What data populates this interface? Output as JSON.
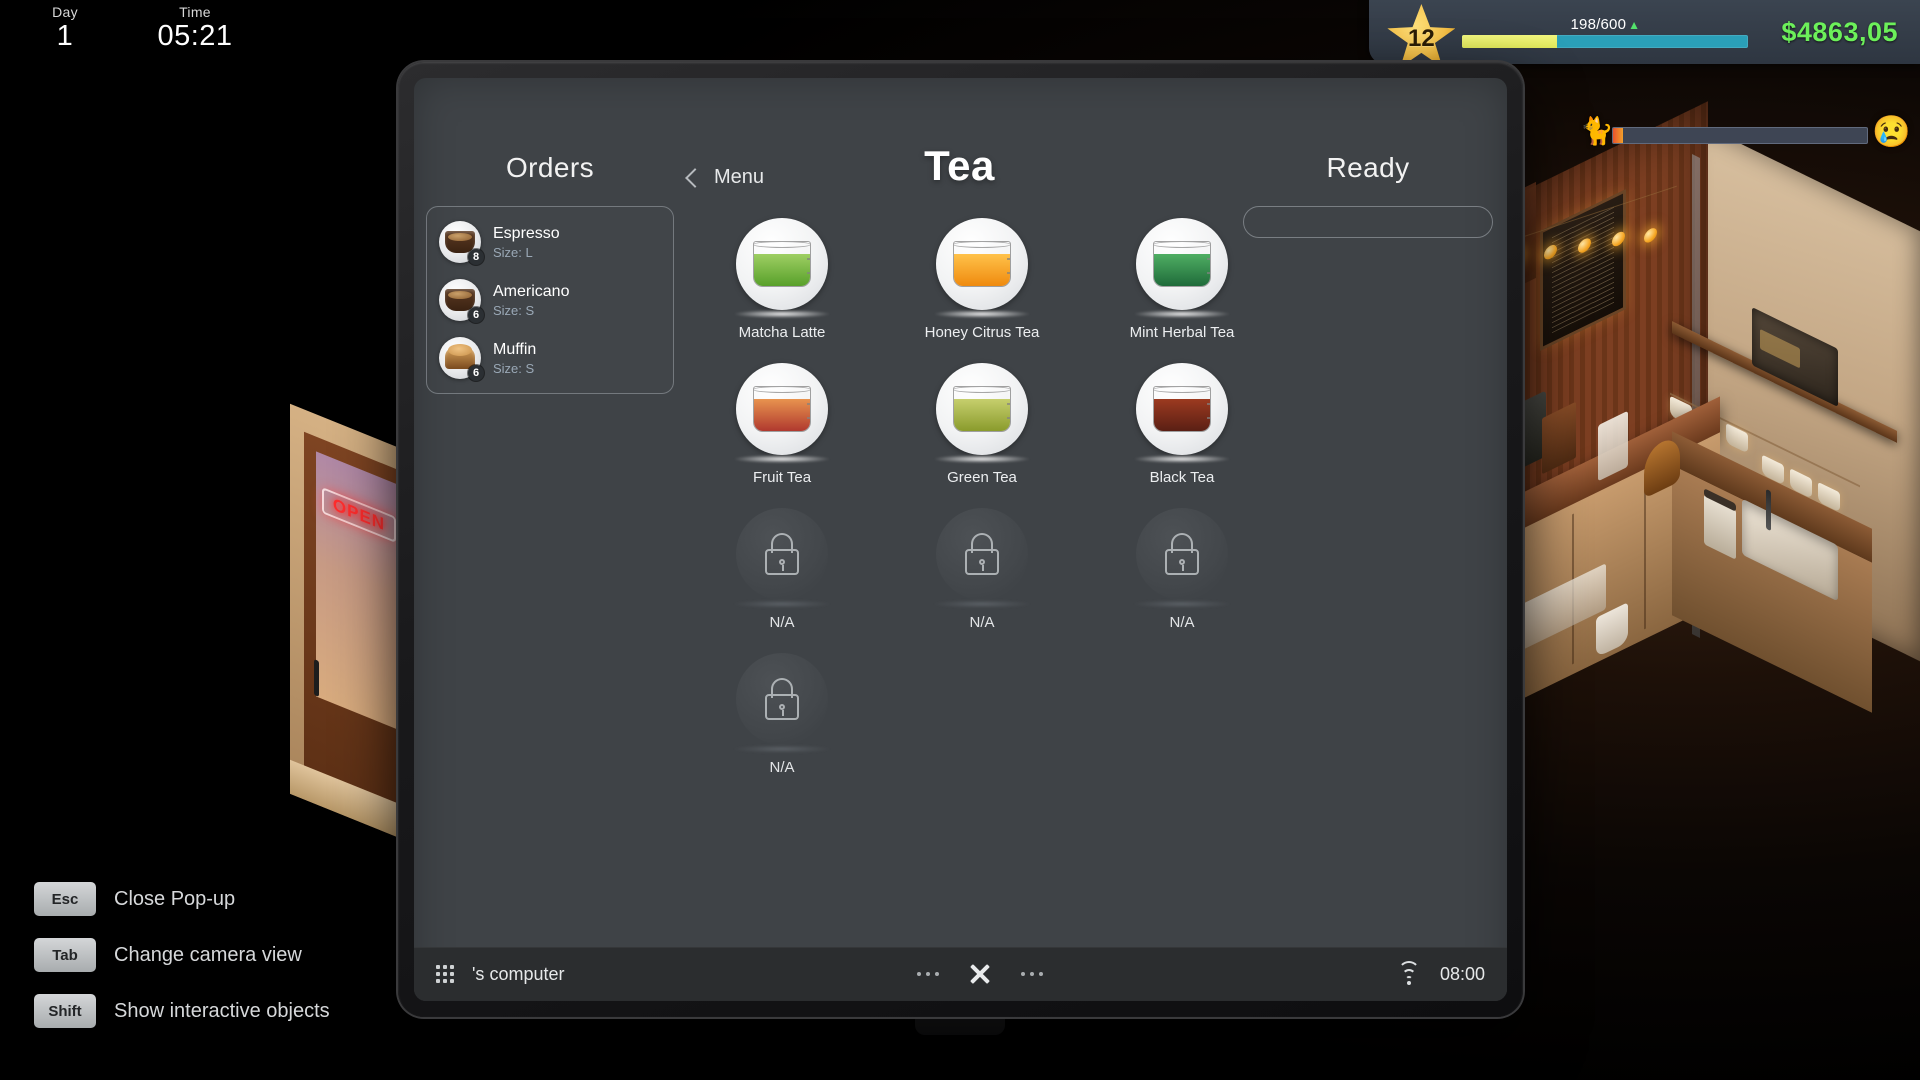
{
  "hud": {
    "day_label": "Day",
    "day_value": "1",
    "time_label": "Time",
    "time_value": "05:21",
    "star_level": "12",
    "xp_text": "198/600",
    "xp_arrow": "▲",
    "xp_current": 198,
    "xp_max": 600,
    "xp_percent": 33,
    "money": "$4863,05",
    "money_color": "#6cf05a",
    "xp_fill_color": "#e8ed66",
    "xp_track_color": "#2a9fb8"
  },
  "patience": {
    "customer_icon": "cat-icon",
    "customer_glyph": "🐈",
    "mood_icon": "crying-face-icon",
    "mood_glyph": "😢",
    "fill_percent": 4
  },
  "orders": {
    "title": "Orders",
    "items": [
      {
        "name": "Espresso",
        "size": "Size: L",
        "count": "8",
        "icon": "espresso-cup-icon"
      },
      {
        "name": "Americano",
        "size": "Size: S",
        "count": "6",
        "icon": "americano-cup-icon"
      },
      {
        "name": "Muffin",
        "size": "Size: S",
        "count": "6",
        "icon": "muffin-icon"
      }
    ]
  },
  "menu": {
    "back_label": "Menu",
    "back_icon": "chevron-left-icon",
    "page_title": "Tea",
    "items": [
      {
        "label": "Matcha Latte",
        "locked": false,
        "liquid": "#58a02a",
        "liquid2": "#9ecf63",
        "icon": "matcha-latte-icon"
      },
      {
        "label": "Honey Citrus Tea",
        "locked": false,
        "liquid": "#ef8a0e",
        "liquid2": "#ffc24a",
        "icon": "honey-citrus-tea-icon"
      },
      {
        "label": "Mint Herbal Tea",
        "locked": false,
        "liquid": "#1f6b3a",
        "liquid2": "#4fae63",
        "icon": "mint-herbal-tea-icon"
      },
      {
        "label": "Fruit Tea",
        "locked": false,
        "liquid": "#b0392f",
        "liquid2": "#e8934f",
        "icon": "fruit-tea-icon"
      },
      {
        "label": "Green Tea",
        "locked": false,
        "liquid": "#8a9b2c",
        "liquid2": "#c6cf6d",
        "icon": "green-tea-icon"
      },
      {
        "label": "Black Tea",
        "locked": false,
        "liquid": "#5a1f14",
        "liquid2": "#9c3a20",
        "icon": "black-tea-icon"
      },
      {
        "label": "N/A",
        "locked": true,
        "icon": "lock-icon"
      },
      {
        "label": "N/A",
        "locked": true,
        "icon": "lock-icon"
      },
      {
        "label": "N/A",
        "locked": true,
        "icon": "lock-icon"
      },
      {
        "label": "N/A",
        "locked": true,
        "icon": "lock-icon"
      }
    ]
  },
  "ready": {
    "title": "Ready",
    "slots": []
  },
  "taskbar": {
    "apps_icon": "app-grid-icon",
    "computer_label": "'s computer",
    "left_dots": "...",
    "close_icon": "close-x-icon",
    "right_dots": "...",
    "wifi_icon": "wifi-icon",
    "clock": "08:00"
  },
  "hints": [
    {
      "key": "Esc",
      "action": "Close Pop-up"
    },
    {
      "key": "Tab",
      "action": "Change camera view"
    },
    {
      "key": "Shift",
      "action": "Show interactive objects"
    }
  ],
  "scene": {
    "door_sign": "OPEN"
  }
}
